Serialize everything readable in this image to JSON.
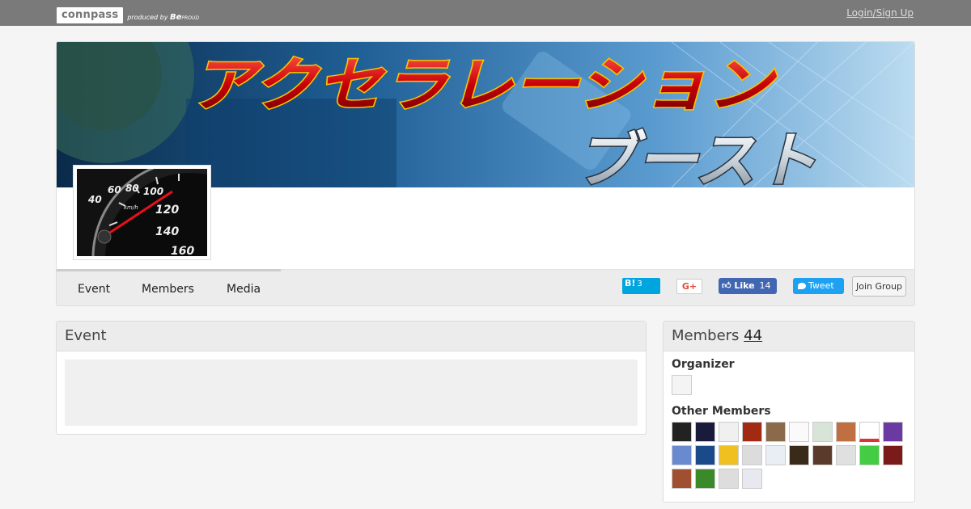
{
  "header": {
    "logo_text": "connpass",
    "logo_sub": "produced by",
    "logo_brand": "Be",
    "logo_brand_sub": "PROUD",
    "login_label": "Login/Sign Up"
  },
  "group": {
    "banner_title": "アクセラレーション",
    "banner_subtitle": "ブースト",
    "speedo_numbers": [
      "40",
      "60",
      "80",
      "100",
      "120",
      "140",
      "160"
    ],
    "speedo_unit": "km/h"
  },
  "nav": {
    "items": [
      "Event",
      "Members",
      "Media"
    ]
  },
  "share": {
    "hatena_label": "B!",
    "hatena_count": "3",
    "gplus_label": "G+",
    "like_label": "Like",
    "like_count": "14",
    "tweet_label": "Tweet",
    "join_label": "Join Group"
  },
  "event_panel": {
    "title": "Event"
  },
  "members_panel": {
    "title": "Members",
    "count": "44",
    "organizer_label": "Organizer",
    "other_label": "Other Members"
  },
  "colors": {
    "topbar": "#7a7a7a",
    "hatena": "#00a4de",
    "facebook": "#4267b2",
    "twitter": "#1da1f2"
  }
}
